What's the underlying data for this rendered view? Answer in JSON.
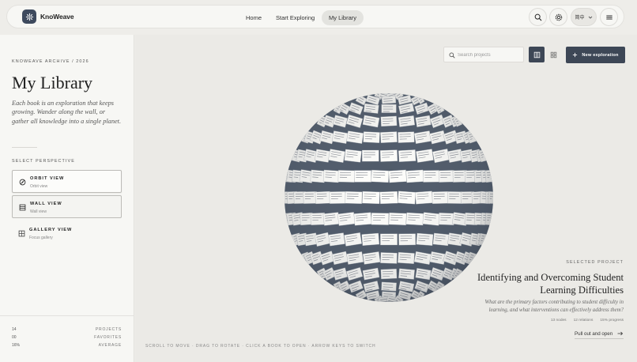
{
  "app": {
    "name": "KnoWeave",
    "colors": {
      "accent": "#3d4756",
      "background": "#eeede9",
      "panel": "#f7f7f4"
    }
  },
  "nav": {
    "links": [
      {
        "label": "Home"
      },
      {
        "label": "Start Exploring"
      },
      {
        "label": "My Library",
        "active": true
      }
    ],
    "language": "简中",
    "icons": [
      "search-icon",
      "gear-icon",
      "chevron-down-icon",
      "hamburger-icon"
    ]
  },
  "sidebar": {
    "eyebrow": "KNOWEAVE ARCHIVE / 2026",
    "title": "My Library",
    "description": "Each book is an exploration that keeps growing. Wander along the wall, or gather all knowledge into a single planet.",
    "perspective_label": "SELECT PERSPECTIVE",
    "views": [
      {
        "name": "ORBIT VIEW",
        "sub": "Orbit view",
        "icon": "orbit-icon",
        "selected": true
      },
      {
        "name": "WALL VIEW",
        "sub": "Wall view",
        "icon": "wall-icon"
      },
      {
        "name": "GALLERY VIEW",
        "sub": "Focus gallery",
        "icon": "gallery-icon"
      }
    ],
    "stats": [
      {
        "value": "14",
        "label": "PROJECTS"
      },
      {
        "value": "00",
        "label": "FAVORITES"
      },
      {
        "value": "16%",
        "label": "AVERAGE"
      }
    ]
  },
  "main": {
    "search": {
      "placeholder": "Search projects"
    },
    "new_button": "New exploration",
    "selected": {
      "label": "SELECTED PROJECT",
      "title": "Identifying and Overcoming Student Learning Difficulties",
      "description": "What are the primary factors contributing to student difficulty in learning, and what interventions can effectively address them?",
      "meta": [
        "13 nodes",
        "12 relations",
        "15% progress"
      ],
      "pull_out": "Pull out and open"
    },
    "hint": "SCROLL TO MOVE · DRAG TO ROTATE · CLICK A BOOK TO OPEN · ARROW KEYS TO SWITCH"
  }
}
